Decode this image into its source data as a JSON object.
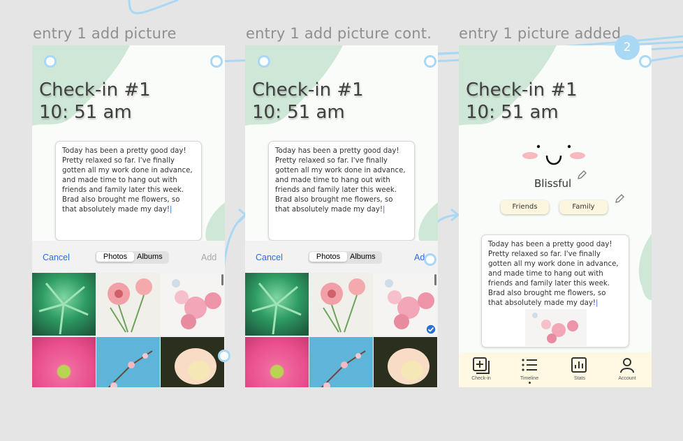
{
  "frames": [
    {
      "title": "entry 1 add picture"
    },
    {
      "title": "entry 1 add picture cont."
    },
    {
      "title": "entry 1 picture added"
    }
  ],
  "checkin": {
    "line1": "Check-in #1",
    "line2": "10: 51 am"
  },
  "entry_text": "Today has been a pretty good day! Pretty relaxed so far. I've finally gotten all my work done in advance, and made time to hang out with friends and family later this week. Brad also brought me flowers, so that absolutely made my day!",
  "picker": {
    "cancel": "Cancel",
    "photos": "Photos",
    "albums": "Albums",
    "add": "Add",
    "add_partial": "Ad"
  },
  "mood": {
    "label": "Blissful"
  },
  "tags": [
    "Friends",
    "Family"
  ],
  "badge": "2",
  "tabs": [
    "Check-in",
    "Timeline",
    "Stats",
    "Account"
  ],
  "colors": {
    "accent_blue": "#2b6fd8",
    "connector": "#a9d8f5",
    "green_blob": "#cfe7d7",
    "tabbar": "#fff9e4",
    "chip": "#fdf6df"
  }
}
